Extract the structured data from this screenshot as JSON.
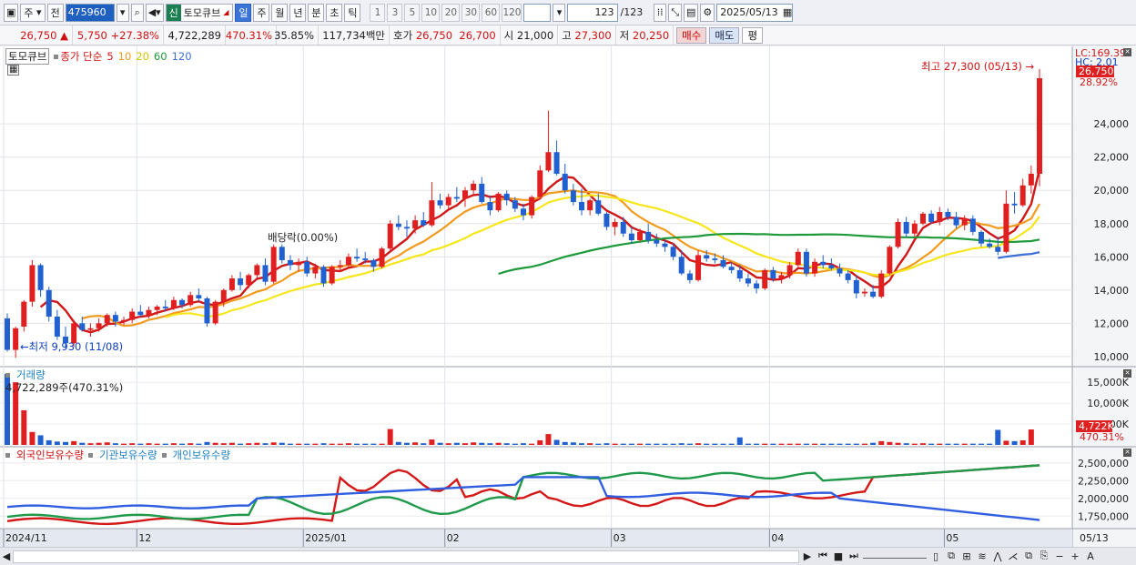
{
  "toolbar": {
    "type_label": "주",
    "prev_label": "전",
    "code": "475960",
    "badge": "신",
    "stock_name": "토모큐브",
    "periods": [
      "일",
      "주",
      "월",
      "년",
      "분",
      "초",
      "틱"
    ],
    "active_period": "일",
    "intervals": [
      "1",
      "3",
      "5",
      "10",
      "20",
      "30",
      "60",
      "120"
    ],
    "count": "123",
    "count_total": "/123",
    "date": "2025/05/13"
  },
  "quote": {
    "price": "26,750",
    "change_arrow": "▲",
    "change": "5,750",
    "change_rate": "+27.38%",
    "volume": "4,722,289",
    "volume_ratio": "470.31%",
    "turnover": "35.85%",
    "amount": "117,734백만",
    "ask_label": "호가",
    "ask": "26,750",
    "bid": "26,700",
    "open_label": "시",
    "open": "21,000",
    "high_label": "고",
    "high": "27,300",
    "low_label": "저",
    "low": "20,250",
    "buy_label": "매수",
    "sell_label": "매도",
    "avg_label": "평"
  },
  "legend": {
    "stock": "토모큐브",
    "price_label": "종가 단순",
    "ma": [
      {
        "label": "5",
        "color": "#d01818"
      },
      {
        "label": "10",
        "color": "#f29a1e"
      },
      {
        "label": "20",
        "color": "#f7e61c"
      },
      {
        "label": "60",
        "color": "#1e9a3a"
      },
      {
        "label": "120",
        "color": "#3d6fd6"
      }
    ],
    "volume_label": "거래량",
    "volume_value": "4,722,289주(470.31%)",
    "holdings": [
      "외국인보유수량",
      "기관보유수량",
      "개인보유수량"
    ]
  },
  "annotations": {
    "high": "최고 27,300 (05/13) →",
    "low": "←최저 9,930 (11/08)",
    "dividend": "배당락(0.00%)",
    "lc": "LC:169.39",
    "hc": "HC: 2.01",
    "last_price": "26,750",
    "last_rate": "28.92%",
    "vol_last": "4,722K",
    "vol_rate": "470.31%"
  },
  "axes": {
    "price_ticks": [
      "24,000",
      "22,000",
      "20,000",
      "18,000",
      "16,000",
      "14,000",
      "12,000",
      "10,000"
    ],
    "volume_ticks": [
      "15,000K",
      "10,000K",
      "5,000K"
    ],
    "holdings_ticks": [
      "2,500,000",
      "2,250,000",
      "2,000,000",
      "1,750,000"
    ],
    "dates": [
      "2024/11",
      "12",
      "2025/01",
      "02",
      "03",
      "04",
      "05",
      "05/13"
    ]
  },
  "chart_data": {
    "type": "line",
    "title": "",
    "price_range": [
      9500,
      28500
    ],
    "volume_range": [
      0,
      17000
    ],
    "holdings_range": [
      1600000,
      2600000
    ],
    "candles_ohlc": [
      [
        12300,
        12600,
        10300,
        10400
      ],
      [
        10400,
        11800,
        9930,
        11700
      ],
      [
        11800,
        13400,
        11500,
        13300
      ],
      [
        13300,
        15800,
        13000,
        15500
      ],
      [
        15500,
        15600,
        13600,
        14000
      ],
      [
        14000,
        14200,
        12100,
        12400
      ],
      [
        12400,
        12800,
        11000,
        11200
      ],
      [
        11200,
        11800,
        10500,
        10800
      ],
      [
        10800,
        12200,
        10600,
        12000
      ],
      [
        12000,
        12400,
        11500,
        11600
      ],
      [
        11600,
        12000,
        11200,
        11700
      ],
      [
        11700,
        12300,
        11500,
        12000
      ],
      [
        12000,
        12600,
        11800,
        12500
      ],
      [
        12500,
        12700,
        11800,
        12100
      ],
      [
        12100,
        12400,
        11900,
        12200
      ],
      [
        12200,
        12900,
        12000,
        12700
      ],
      [
        12700,
        13100,
        12400,
        12500
      ],
      [
        12500,
        13000,
        12300,
        12800
      ],
      [
        12800,
        13100,
        12500,
        13000
      ],
      [
        13000,
        13400,
        12700,
        12900
      ],
      [
        12900,
        13600,
        12800,
        13400
      ],
      [
        13400,
        13500,
        12900,
        13100
      ],
      [
        13100,
        13900,
        13000,
        13700
      ],
      [
        13700,
        14100,
        13300,
        13500
      ],
      [
        13500,
        13600,
        11800,
        12000
      ],
      [
        12000,
        13400,
        11900,
        13300
      ],
      [
        13300,
        14100,
        13000,
        14000
      ],
      [
        14000,
        14900,
        13900,
        14700
      ],
      [
        14700,
        15100,
        14000,
        14300
      ],
      [
        14300,
        15000,
        14100,
        14900
      ],
      [
        14900,
        15600,
        14700,
        15500
      ],
      [
        15500,
        15900,
        14300,
        14500
      ],
      [
        14500,
        16800,
        14400,
        16600
      ],
      [
        16600,
        16900,
        15600,
        15800
      ],
      [
        15800,
        16100,
        15200,
        15500
      ],
      [
        15500,
        15900,
        15100,
        15700
      ],
      [
        15700,
        16000,
        14800,
        15000
      ],
      [
        15000,
        15600,
        14700,
        15400
      ],
      [
        15400,
        15500,
        14200,
        14400
      ],
      [
        14400,
        15500,
        14300,
        15400
      ],
      [
        15400,
        15800,
        15100,
        15500
      ],
      [
        15500,
        16200,
        15400,
        16000
      ],
      [
        16000,
        16500,
        15700,
        15900
      ],
      [
        15900,
        16300,
        15600,
        15800
      ],
      [
        15800,
        15900,
        15100,
        15400
      ],
      [
        15400,
        16600,
        15300,
        16500
      ],
      [
        16500,
        18200,
        16400,
        18000
      ],
      [
        18000,
        18500,
        17600,
        17800
      ],
      [
        17800,
        18200,
        17200,
        17700
      ],
      [
        17700,
        18500,
        17400,
        18200
      ],
      [
        18200,
        18700,
        17800,
        17900
      ],
      [
        17900,
        20500,
        17800,
        19400
      ],
      [
        19400,
        19800,
        18900,
        19100
      ],
      [
        19100,
        19800,
        18900,
        19600
      ],
      [
        19600,
        20200,
        19300,
        19500
      ],
      [
        19500,
        20200,
        19000,
        20000
      ],
      [
        20000,
        20600,
        19700,
        20400
      ],
      [
        20400,
        20800,
        19200,
        19300
      ],
      [
        19300,
        19700,
        18500,
        18800
      ],
      [
        18800,
        19900,
        18700,
        19800
      ],
      [
        19800,
        20000,
        19100,
        19400
      ],
      [
        19400,
        19600,
        18700,
        18900
      ],
      [
        18900,
        19200,
        18200,
        18500
      ],
      [
        18500,
        19700,
        18300,
        19600
      ],
      [
        19600,
        21500,
        19500,
        21200
      ],
      [
        21200,
        24800,
        21100,
        22300
      ],
      [
        22300,
        23000,
        20900,
        21000
      ],
      [
        21000,
        21600,
        19800,
        20000
      ],
      [
        20000,
        20400,
        19100,
        19300
      ],
      [
        19300,
        20100,
        18500,
        18800
      ],
      [
        18800,
        19500,
        18500,
        19400
      ],
      [
        19400,
        19800,
        18500,
        18600
      ],
      [
        18600,
        18700,
        17600,
        17800
      ],
      [
        17800,
        18300,
        17300,
        18100
      ],
      [
        18100,
        18400,
        17200,
        17400
      ],
      [
        17400,
        17800,
        16800,
        17000
      ],
      [
        17000,
        17700,
        16900,
        17500
      ],
      [
        17500,
        18000,
        16800,
        17000
      ],
      [
        17000,
        17400,
        16600,
        16800
      ],
      [
        16800,
        17000,
        16300,
        16600
      ],
      [
        16600,
        16800,
        15800,
        16000
      ],
      [
        16000,
        16400,
        14900,
        15000
      ],
      [
        15000,
        15200,
        14400,
        14600
      ],
      [
        14600,
        16400,
        14500,
        16100
      ],
      [
        16100,
        16400,
        15700,
        15900
      ],
      [
        15900,
        16200,
        15600,
        15800
      ],
      [
        15800,
        16100,
        15300,
        15400
      ],
      [
        15400,
        15700,
        15000,
        15200
      ],
      [
        15200,
        15500,
        14500,
        14700
      ],
      [
        14700,
        15000,
        14200,
        14400
      ],
      [
        14400,
        14600,
        13800,
        14100
      ],
      [
        14100,
        15300,
        14000,
        15200
      ],
      [
        15200,
        15400,
        14500,
        14700
      ],
      [
        14700,
        15100,
        14400,
        14900
      ],
      [
        14900,
        15700,
        14700,
        15500
      ],
      [
        15500,
        16500,
        15400,
        16300
      ],
      [
        16300,
        16500,
        14800,
        15000
      ],
      [
        15000,
        15900,
        14800,
        15700
      ],
      [
        15700,
        16100,
        15300,
        15500
      ],
      [
        15500,
        15900,
        15200,
        15300
      ],
      [
        15300,
        15600,
        14800,
        15000
      ],
      [
        15000,
        15200,
        14400,
        14600
      ],
      [
        14600,
        14900,
        13500,
        13800
      ],
      [
        13800,
        14100,
        13600,
        13900
      ],
      [
        13900,
        14300,
        13500,
        13600
      ],
      [
        13600,
        15200,
        13500,
        15000
      ],
      [
        15000,
        16700,
        14900,
        16600
      ],
      [
        16600,
        18300,
        16500,
        18100
      ],
      [
        18100,
        18400,
        17200,
        17400
      ],
      [
        17400,
        18200,
        17200,
        18000
      ],
      [
        18000,
        18700,
        17900,
        18600
      ],
      [
        18600,
        18800,
        18000,
        18100
      ],
      [
        18100,
        19000,
        17900,
        18700
      ],
      [
        18700,
        18900,
        18200,
        18400
      ],
      [
        18400,
        18700,
        17700,
        17900
      ],
      [
        17900,
        18500,
        17600,
        18300
      ],
      [
        18300,
        18500,
        17300,
        17500
      ],
      [
        17500,
        17600,
        16600,
        16800
      ],
      [
        16800,
        17100,
        16500,
        16600
      ],
      [
        16600,
        17200,
        16100,
        16300
      ],
      [
        16300,
        20000,
        16200,
        19200
      ],
      [
        19200,
        19900,
        18600,
        19100
      ],
      [
        19100,
        20700,
        19000,
        20300
      ],
      [
        20300,
        21500,
        19800,
        21000
      ],
      [
        21000,
        27300,
        20250,
        26750
      ]
    ],
    "volume_k": [
      17000,
      15000,
      8300,
      3100,
      2300,
      1100,
      800,
      700,
      900,
      500,
      400,
      500,
      600,
      400,
      300,
      400,
      300,
      400,
      300,
      300,
      400,
      300,
      400,
      300,
      700,
      500,
      400,
      500,
      300,
      400,
      500,
      400,
      600,
      500,
      300,
      300,
      300,
      300,
      400,
      300,
      300,
      400,
      300,
      300,
      300,
      300,
      3800,
      700,
      500,
      600,
      400,
      1300,
      500,
      400,
      500,
      400,
      600,
      500,
      400,
      500,
      400,
      300,
      400,
      300,
      1100,
      2600,
      1200,
      700,
      600,
      400,
      400,
      300,
      400,
      300,
      300,
      300,
      300,
      300,
      300,
      300,
      300,
      400,
      300,
      400,
      300,
      300,
      300,
      300,
      1800,
      300,
      300,
      300,
      300,
      300,
      300,
      300,
      300,
      300,
      300,
      300,
      300,
      300,
      300,
      300,
      500,
      900,
      700,
      500,
      400,
      300,
      400,
      300,
      300,
      300,
      300,
      300,
      300,
      300,
      300,
      3600,
      1000,
      900,
      1100,
      3700
    ],
    "holdings_series": [
      {
        "name": "외국인보유수량",
        "color": "#d41818"
      },
      {
        "name": "기관보유수량",
        "color": "#1f9a4a"
      },
      {
        "name": "개인보유수량",
        "color": "#2f5fe0"
      }
    ]
  }
}
